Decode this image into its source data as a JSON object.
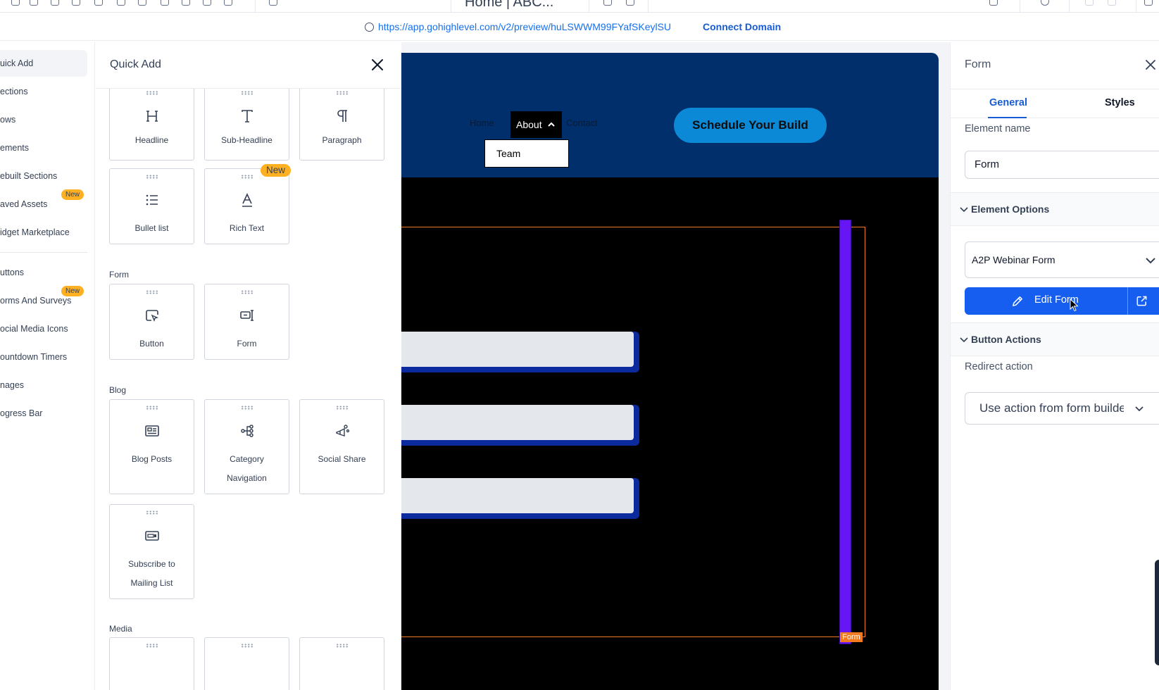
{
  "toolbar": {
    "page_tab_title": "Home | ABC..."
  },
  "urlbar": {
    "url": "https://app.gohighlevel.com/v2/preview/huLSWWM99FYafSKeylSU",
    "connect_domain": "Connect Domain"
  },
  "left_nav": {
    "items": [
      {
        "label": "uick Add"
      },
      {
        "label": "ections"
      },
      {
        "label": "ows"
      },
      {
        "label": "ements"
      },
      {
        "label": "ebuilt Sections"
      },
      {
        "label": "aved Assets",
        "badge": "New"
      },
      {
        "label": "idget Marketplace"
      },
      {
        "label": "uttons"
      },
      {
        "label": "orms And Surveys",
        "badge": "New"
      },
      {
        "label": "ocial Media Icons"
      },
      {
        "label": "ountdown Timers"
      },
      {
        "label": "nages"
      },
      {
        "label": "ogress Bar"
      }
    ]
  },
  "quick_add": {
    "title": "Quick Add",
    "cards": {
      "headline": "Headline",
      "sub_headline": "Sub-Headline",
      "paragraph": "Paragraph",
      "bullet_list": "Bullet list",
      "rich_text": "Rich Text",
      "rich_text_badge": "New",
      "button": "Button",
      "form": "Form",
      "blog_posts": "Blog Posts",
      "category_navigation_1": "Category",
      "category_navigation_2": "Navigation",
      "social_share": "Social Share",
      "subscribe_1": "Subscribe to",
      "subscribe_2": "Mailing List"
    },
    "sections": {
      "form": "Form",
      "blog": "Blog",
      "media": "Media"
    }
  },
  "canvas": {
    "menu": {
      "home": "Home",
      "about": "About",
      "contact": "Contact",
      "dropdown_item": "Team"
    },
    "cta_button": "Schedule Your Build",
    "form_tag": "Form"
  },
  "right_panel": {
    "title": "Form",
    "tabs": {
      "general": "General",
      "styles": "Styles"
    },
    "element_name_label": "Element name",
    "element_name_value": "Form",
    "element_options_title": "Element Options",
    "selected_form": "A2P Webinar Form",
    "edit_form_button": "Edit Form",
    "button_actions_title": "Button Actions",
    "redirect_action_label": "Redirect action",
    "redirect_action_value": "Use action from form builder"
  },
  "colors": {
    "accent_blue": "#155eef",
    "site_header": "#002f6c",
    "cta_button": "#0b89d6",
    "selection_outline": "#f27b22",
    "form_bar": "#6615f5",
    "new_badge": "#fdb022"
  },
  "icons": [
    "globe-icon",
    "close-icon",
    "headline-icon",
    "sub-headline-icon",
    "paragraph-icon",
    "bullet-list-icon",
    "rich-text-icon",
    "button-icon",
    "form-icon",
    "blog-posts-icon",
    "category-navigation-icon",
    "social-share-icon",
    "subscribe-icon",
    "chevron-up-icon",
    "chevron-down-icon",
    "pencil-icon",
    "external-link-icon",
    "cursor-icon"
  ]
}
